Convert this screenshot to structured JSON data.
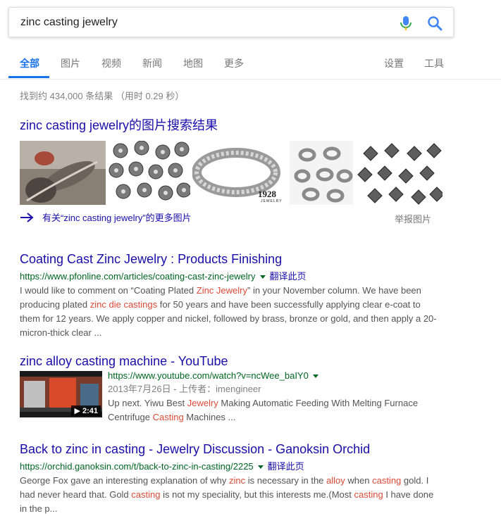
{
  "search": {
    "query": "zinc casting jewelry"
  },
  "tabs": [
    "全部",
    "图片",
    "视频",
    "新闻",
    "地图",
    "更多"
  ],
  "tools": {
    "settings": "设置",
    "tools": "工具"
  },
  "stats": "找到约 434,000 条结果 （用时 0.29 秒）",
  "images": {
    "heading": "zinc casting jewelry的图片搜索结果",
    "more": "有关“zinc casting jewelry”的更多图片",
    "report": "举报图片",
    "thumb_text": {
      "bracelet_logo": "1928",
      "bracelet_logo_sub": "JEWELRY"
    }
  },
  "results": [
    {
      "title": "Coating Cast Zinc Jewelry : Products Finishing",
      "url": "https://www.pfonline.com/articles/coating-cast-zinc-jewelry",
      "translate": "翻译此页",
      "snippet": [
        {
          "t": "I would like to comment on “Coating Plated "
        },
        {
          "t": "Zinc Jewelry",
          "hl": true
        },
        {
          "t": "” in your November column. We have been producing plated "
        },
        {
          "t": "zinc die castings",
          "hl": true
        },
        {
          "t": " for 50 years and have been successfully applying clear e-coat to them for 12 years. We apply copper and nickel, followed by brass, bronze or gold, and then apply a 20-micron-thick clear ..."
        }
      ]
    },
    {
      "title": "zinc alloy casting machine - YouTube",
      "url": "https://www.youtube.com/watch?v=ncWee_baIY0",
      "date": "2013年7月26日 - 上传者：imengineer",
      "duration": "▶ 2:41",
      "snippet": [
        {
          "t": "Up next. Yiwu Best "
        },
        {
          "t": "Jewelry",
          "hl": true
        },
        {
          "t": " Making Automatic Feeding With Melting Furnace Centrifuge "
        },
        {
          "t": "Casting",
          "hl": true
        },
        {
          "t": " Machines ..."
        }
      ]
    },
    {
      "title": "Back to zinc in casting - Jewelry Discussion - Ganoksin Orchid",
      "url": "https://orchid.ganoksin.com/t/back-to-zinc-in-casting/2225",
      "translate": "翻译此页",
      "snippet": [
        {
          "t": "George Fox gave an interesting explanation of why "
        },
        {
          "t": "zinc",
          "hl": true
        },
        {
          "t": " is necessary in the "
        },
        {
          "t": "alloy",
          "hl": true
        },
        {
          "t": " when "
        },
        {
          "t": "casting",
          "hl": true
        },
        {
          "t": " gold. I had never heard that. Gold "
        },
        {
          "t": "casting",
          "hl": true
        },
        {
          "t": " is not my speciality, but this interests me.(Most "
        },
        {
          "t": "casting",
          "hl": true
        },
        {
          "t": " I have done in the p..."
        }
      ]
    }
  ],
  "colors": {
    "link": "#1a0dab",
    "url": "#006621",
    "highlight": "#dd4b39",
    "active_tab": "#1a73e8"
  },
  "icons": [
    "mic-icon",
    "search-icon",
    "arrow-right-icon",
    "play-icon"
  ]
}
